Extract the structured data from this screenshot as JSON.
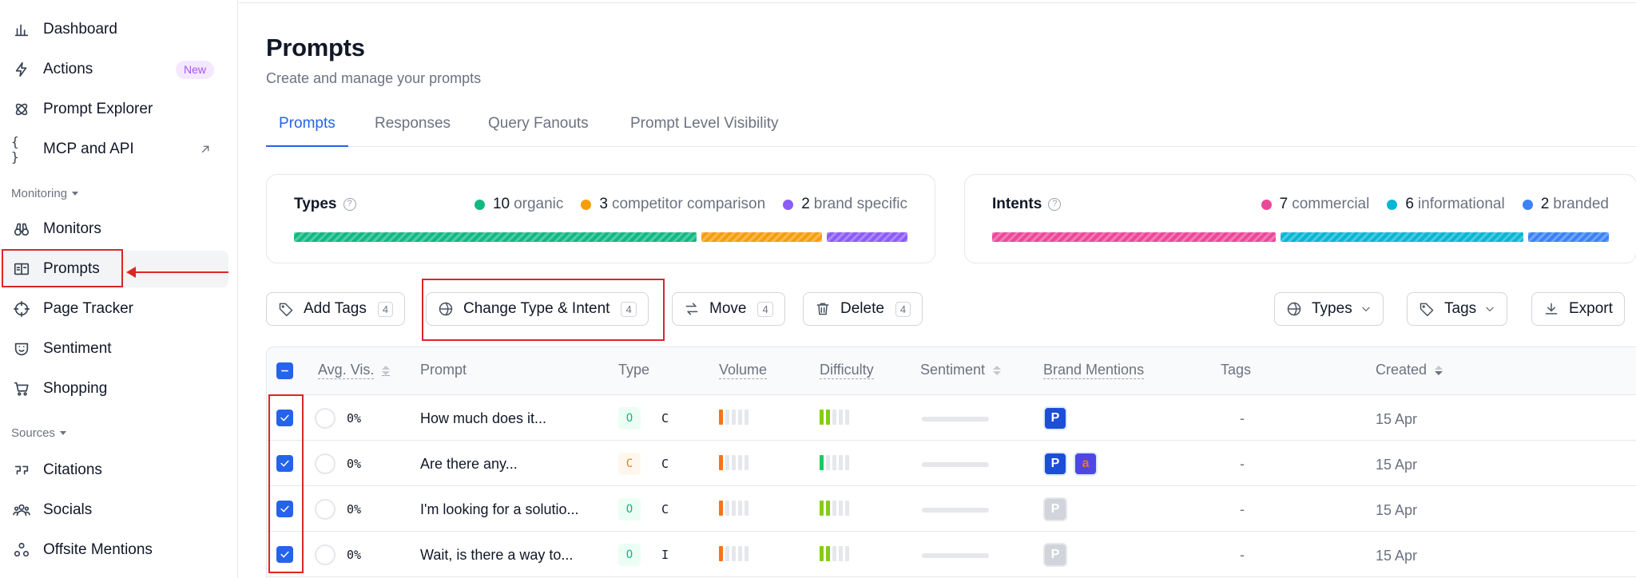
{
  "sidebar": {
    "items": [
      {
        "label": "Dashboard",
        "icon": "bar-chart-icon"
      },
      {
        "label": "Actions",
        "icon": "lightning-icon",
        "badge": "New"
      },
      {
        "label": "Prompt Explorer",
        "icon": "atom-icon"
      },
      {
        "label": "MCP and API",
        "icon": "braces-icon"
      }
    ],
    "monitoring_label": "Monitoring",
    "monitoring_items": [
      {
        "label": "Monitors",
        "icon": "binoculars-icon"
      },
      {
        "label": "Prompts",
        "icon": "prompt-book-icon",
        "active": true
      },
      {
        "label": "Page Tracker",
        "icon": "crosshair-icon"
      },
      {
        "label": "Sentiment",
        "icon": "face-shield-icon"
      },
      {
        "label": "Shopping",
        "icon": "cart-icon"
      }
    ],
    "sources_label": "Sources",
    "sources_items": [
      {
        "label": "Citations",
        "icon": "quote-icon"
      },
      {
        "label": "Socials",
        "icon": "users-icon"
      },
      {
        "label": "Offsite Mentions",
        "icon": "nodes-icon"
      }
    ]
  },
  "page": {
    "title": "Prompts",
    "subtitle": "Create and manage your prompts"
  },
  "tabs": [
    "Prompts",
    "Responses",
    "Query Fanouts",
    "Prompt Level Visibility"
  ],
  "types_card": {
    "title": "Types",
    "items": [
      {
        "count": "10",
        "label": "organic",
        "color": "#10b981"
      },
      {
        "count": "3",
        "label": "competitor comparison",
        "color": "#f59e0b"
      },
      {
        "count": "2",
        "label": "brand specific",
        "color": "#8b5cf6"
      }
    ]
  },
  "intents_card": {
    "title": "Intents",
    "items": [
      {
        "count": "7",
        "label": "commercial",
        "color": "#ec4899"
      },
      {
        "count": "6",
        "label": "informational",
        "color": "#06b6d4"
      },
      {
        "count": "2",
        "label": "branded",
        "color": "#3b82f6"
      }
    ]
  },
  "toolbar": {
    "add_tags": "Add Tags",
    "change_type": "Change Type & Intent",
    "move": "Move",
    "delete": "Delete",
    "selected_count": "4",
    "types_filter": "Types",
    "tags_filter": "Tags",
    "export": "Export"
  },
  "table": {
    "headers": {
      "avg_vis": "Avg. Vis.",
      "prompt": "Prompt",
      "type": "Type",
      "volume": "Volume",
      "difficulty": "Difficulty",
      "sentiment": "Sentiment",
      "brand_mentions": "Brand Mentions",
      "tags": "Tags",
      "created": "Created"
    },
    "rows": [
      {
        "vis": "0%",
        "prompt": "How much does it...",
        "type": "O",
        "intent": "C",
        "tags": "-",
        "created": "15 Apr"
      },
      {
        "vis": "0%",
        "prompt": "Are there any...",
        "type": "C",
        "intent": "C",
        "tags": "-",
        "created": "15 Apr"
      },
      {
        "vis": "0%",
        "prompt": "I'm looking for a solutio...",
        "type": "O",
        "intent": "C",
        "tags": "-",
        "created": "15 Apr"
      },
      {
        "vis": "0%",
        "prompt": "Wait, is there a way to...",
        "type": "O",
        "intent": "I",
        "tags": "-",
        "created": "15 Apr"
      }
    ]
  }
}
